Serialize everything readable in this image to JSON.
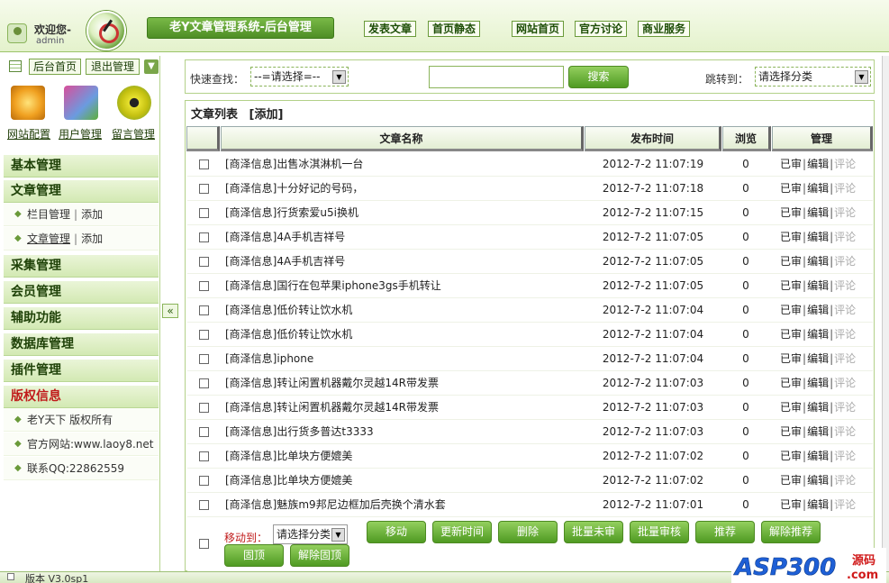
{
  "header": {
    "welcome": "欢迎您-",
    "user": "admin",
    "system_title": "老Y文章管理系统-后台管理",
    "links": [
      "发表文章",
      "首页静态",
      "网站首页",
      "官方讨论",
      "商业服务"
    ]
  },
  "left": {
    "home_button": "后台首页",
    "logout_button": "退出管理",
    "icons": [
      {
        "label": "网站配置",
        "icon": "gear-icon"
      },
      {
        "label": "用户管理",
        "icon": "user-book-icon"
      },
      {
        "label": "留言管理",
        "icon": "radiation-icon"
      }
    ],
    "menus": {
      "basic": "基本管理",
      "article": "文章管理",
      "article_sub1": "栏目管理",
      "article_sub1_add": "添加",
      "article_sub2": "文章管理",
      "article_sub2_add": "添加",
      "collect": "采集管理",
      "member": "会员管理",
      "aux": "辅助功能",
      "db": "数据库管理",
      "plugin": "插件管理",
      "copyright": "版权信息",
      "copy1": "老Y天下 版权所有",
      "copy2": "官方网站:www.laoy8.net",
      "copy3": "联系QQ:22862559"
    },
    "collapse": "«"
  },
  "search": {
    "quick_label": "快速查找：",
    "quick_select": "--=请选择=--",
    "keyword": "",
    "search_button": "搜索",
    "jump_label": "跳转到：",
    "jump_select": "请选择分类"
  },
  "list": {
    "title": "文章列表",
    "add": "[添加]",
    "headers": {
      "name": "文章名称",
      "time": "发布时间",
      "views": "浏览",
      "manage": "管理"
    },
    "rows": [
      {
        "title": "[商泽信息]出售冰淇淋机一台",
        "time": "2012-7-2 11:07:19",
        "views": "0"
      },
      {
        "title": "[商泽信息]十分好记的号码，",
        "time": "2012-7-2 11:07:18",
        "views": "0"
      },
      {
        "title": "[商泽信息]行货索爱u5i换机",
        "time": "2012-7-2 11:07:15",
        "views": "0"
      },
      {
        "title": "[商泽信息]4A手机吉祥号",
        "time": "2012-7-2 11:07:05",
        "views": "0"
      },
      {
        "title": "[商泽信息]4A手机吉祥号",
        "time": "2012-7-2 11:07:05",
        "views": "0"
      },
      {
        "title": "[商泽信息]国行在包苹果iphone3gs手机转让",
        "time": "2012-7-2 11:07:05",
        "views": "0"
      },
      {
        "title": "[商泽信息]低价转让饮水机",
        "time": "2012-7-2 11:07:04",
        "views": "0"
      },
      {
        "title": "[商泽信息]低价转让饮水机",
        "time": "2012-7-2 11:07:04",
        "views": "0"
      },
      {
        "title": "[商泽信息]iphone",
        "time": "2012-7-2 11:07:04",
        "views": "0"
      },
      {
        "title": "[商泽信息]转让闲置机器戴尔灵越14R带发票",
        "time": "2012-7-2 11:07:03",
        "views": "0"
      },
      {
        "title": "[商泽信息]转让闲置机器戴尔灵越14R带发票",
        "time": "2012-7-2 11:07:03",
        "views": "0"
      },
      {
        "title": "[商泽信息]出行货多普达t3333",
        "time": "2012-7-2 11:07:03",
        "views": "0"
      },
      {
        "title": "[商泽信息]比单块方便媲美",
        "time": "2012-7-2 11:07:02",
        "views": "0"
      },
      {
        "title": "[商泽信息]比单块方便媲美",
        "time": "2012-7-2 11:07:02",
        "views": "0"
      },
      {
        "title": "[商泽信息]魅族m9邦尼边框加后壳换个清水套",
        "time": "2012-7-2 11:07:01",
        "views": "0"
      }
    ],
    "manage_links": {
      "approved": "已审",
      "edit": "编辑",
      "comment": "评论"
    }
  },
  "actions": {
    "move_label": "移动到：",
    "move_select": "请选择分类",
    "buttons": [
      "移动",
      "更新时间",
      "删除",
      "批量未审",
      "批量审核",
      "推荐",
      "解除推荐",
      "固顶",
      "解除固顶"
    ]
  },
  "status": {
    "version": "版本 V3.0sp1"
  },
  "watermark": {
    "brand": "ASP300",
    "domain_text": "源码",
    "suffix": ".com"
  },
  "colors": {
    "brand_green": "#4e8e25",
    "accent_red": "#c01a1a"
  }
}
